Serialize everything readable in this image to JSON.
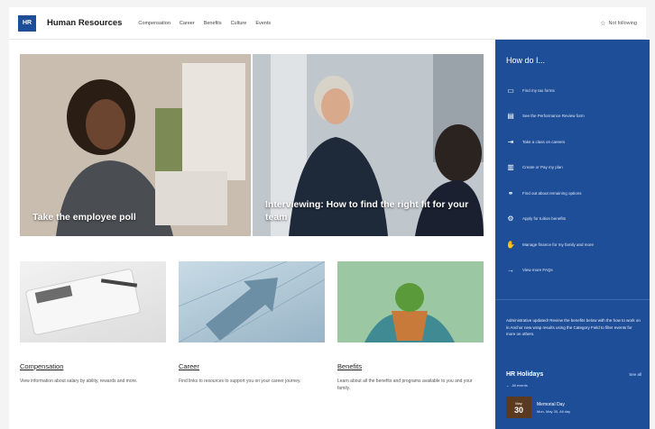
{
  "header": {
    "logo_text": "HR",
    "site_title": "Human Resources",
    "nav": [
      "Compensation",
      "Career",
      "Benefits",
      "Culture",
      "Events"
    ],
    "following_label": "Not following"
  },
  "hero": {
    "tiles": [
      {
        "caption": "Take the employee poll"
      },
      {
        "caption": "Interviewing: How to find the right fit for your team"
      }
    ]
  },
  "cards": [
    {
      "title": "Compensation",
      "description": "View information about salary by ability, rewards and more."
    },
    {
      "title": "Career",
      "description": "Find links to resources to support you on your career journey."
    },
    {
      "title": "Benefits",
      "description": "Learn about all the benefits and programs available to you and your family."
    }
  ],
  "sidebar": {
    "heading": "How do I...",
    "items": [
      {
        "label": "Find my tax forms",
        "icon": "document-icon"
      },
      {
        "label": "See the Performance Review form",
        "icon": "clipboard-icon"
      },
      {
        "label": "Take a class on careers",
        "icon": "sign-in-icon"
      },
      {
        "label": "Create or Pay my plan",
        "icon": "chart-icon"
      },
      {
        "label": "Find out about remaining options",
        "icon": "link-icon"
      },
      {
        "label": "Apply for tuition benefits",
        "icon": "gear-icon"
      },
      {
        "label": "Manage finance for my family and more",
        "icon": "hand-money-icon"
      },
      {
        "label": "View more FAQs",
        "icon": "arrow-icon"
      }
    ],
    "note": "Administrative updated! Review the benefits below with the how to work on in Anchor new wrap results using the Category Field to filter events for more on others.",
    "holidays": {
      "title": "HR Holidays",
      "see_all": "See all",
      "subtitle": "All events",
      "event": {
        "month": "May",
        "day": "30",
        "name": "Memorial Day",
        "date": "Mon, May 30, All day"
      }
    }
  }
}
